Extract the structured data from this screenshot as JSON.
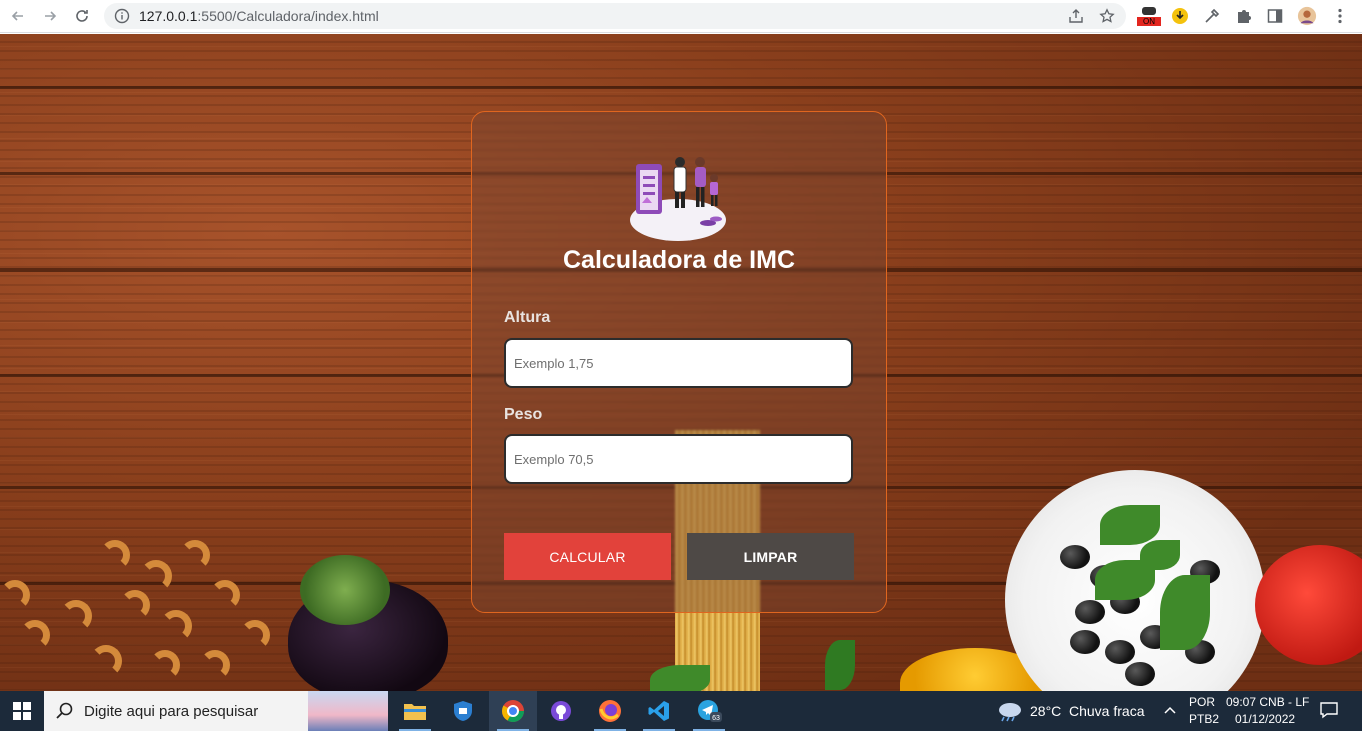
{
  "browser": {
    "url_host": "127.0.0.1",
    "url_path": ":5500/Calculadora/index.html",
    "ext_badge": "ON"
  },
  "app": {
    "title": "Calculadora de IMC",
    "height_label": "Altura",
    "height_placeholder": "Exemplo 1,75",
    "weight_label": "Peso",
    "weight_placeholder": "Exemplo 70,5",
    "calculate_label": "CALCULAR",
    "clear_label": "LIMPAR"
  },
  "taskbar": {
    "search_placeholder": "Digite aqui para pesquisar",
    "telegram_badge": "63",
    "temperature": "28°C",
    "weather": "Chuva fraca",
    "language": "POR",
    "keyboard": "PTB2",
    "time": "09:07 CNB - LF",
    "date": "01/12/2022"
  },
  "colors": {
    "card_border": "#e0661f",
    "calculate_button": "#e2423b",
    "clear_button": "#4e4946",
    "taskbar": "#1c2a3a"
  }
}
